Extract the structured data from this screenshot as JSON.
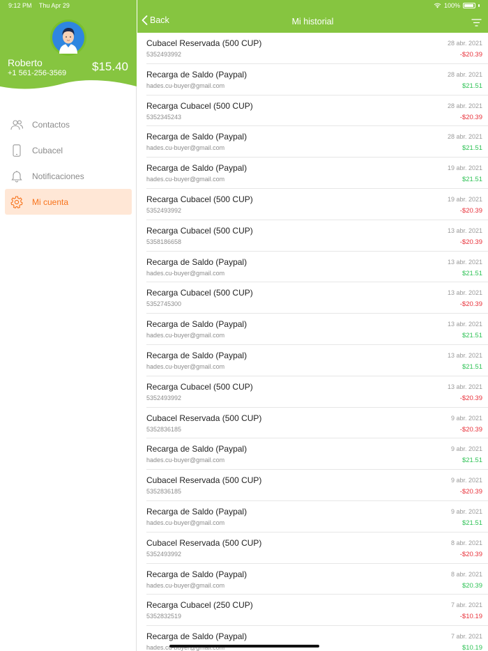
{
  "status_bar": {
    "time": "9:12 PM",
    "date": "Thu Apr 29",
    "battery": "100%"
  },
  "profile": {
    "name": "Roberto",
    "phone": "+1 561-256-3569",
    "balance": "$15.40"
  },
  "menu": [
    {
      "label": "Contactos",
      "icon": "contacts-icon"
    },
    {
      "label": "Cubacel",
      "icon": "phone-icon"
    },
    {
      "label": "Notificaciones",
      "icon": "bell-icon"
    },
    {
      "label": "Mi cuenta",
      "icon": "gear-icon",
      "active": true
    }
  ],
  "navbar": {
    "back_label": "Back",
    "title": "Mi historial"
  },
  "colors": {
    "brand_green": "#86c540",
    "accent_orange": "#f7731c",
    "negative": "#e8313a",
    "positive": "#2ec255"
  },
  "transactions": [
    {
      "title": "Cubacel Reservada (500 CUP)",
      "subtitle": "5352493992",
      "date": "28 abr. 2021",
      "amount": "-$20.39",
      "type": "neg"
    },
    {
      "title": "Recarga de Saldo (Paypal)",
      "subtitle": "hades.cu-buyer@gmail.com",
      "date": "28 abr. 2021",
      "amount": "$21.51",
      "type": "pos"
    },
    {
      "title": "Recarga Cubacel (500 CUP)",
      "subtitle": "5352345243",
      "date": "28 abr. 2021",
      "amount": "-$20.39",
      "type": "neg"
    },
    {
      "title": "Recarga de Saldo (Paypal)",
      "subtitle": "hades.cu-buyer@gmail.com",
      "date": "28 abr. 2021",
      "amount": "$21.51",
      "type": "pos"
    },
    {
      "title": "Recarga de Saldo (Paypal)",
      "subtitle": "hades.cu-buyer@gmail.com",
      "date": "19 abr. 2021",
      "amount": "$21.51",
      "type": "pos"
    },
    {
      "title": "Recarga Cubacel (500 CUP)",
      "subtitle": "5352493992",
      "date": "19 abr. 2021",
      "amount": "-$20.39",
      "type": "neg"
    },
    {
      "title": "Recarga Cubacel (500 CUP)",
      "subtitle": "5358186658",
      "date": "13 abr. 2021",
      "amount": "-$20.39",
      "type": "neg"
    },
    {
      "title": "Recarga de Saldo (Paypal)",
      "subtitle": "hades.cu-buyer@gmail.com",
      "date": "13 abr. 2021",
      "amount": "$21.51",
      "type": "pos"
    },
    {
      "title": "Recarga Cubacel (500 CUP)",
      "subtitle": "5352745300",
      "date": "13 abr. 2021",
      "amount": "-$20.39",
      "type": "neg"
    },
    {
      "title": "Recarga de Saldo (Paypal)",
      "subtitle": "hades.cu-buyer@gmail.com",
      "date": "13 abr. 2021",
      "amount": "$21.51",
      "type": "pos"
    },
    {
      "title": "Recarga de Saldo (Paypal)",
      "subtitle": "hades.cu-buyer@gmail.com",
      "date": "13 abr. 2021",
      "amount": "$21.51",
      "type": "pos"
    },
    {
      "title": "Recarga Cubacel (500 CUP)",
      "subtitle": "5352493992",
      "date": "13 abr. 2021",
      "amount": "-$20.39",
      "type": "neg"
    },
    {
      "title": "Cubacel Reservada (500 CUP)",
      "subtitle": "5352836185",
      "date": "9 abr. 2021",
      "amount": "-$20.39",
      "type": "neg"
    },
    {
      "title": "Recarga de Saldo (Paypal)",
      "subtitle": "hades.cu-buyer@gmail.com",
      "date": "9 abr. 2021",
      "amount": "$21.51",
      "type": "pos"
    },
    {
      "title": "Cubacel Reservada (500 CUP)",
      "subtitle": "5352836185",
      "date": "9 abr. 2021",
      "amount": "-$20.39",
      "type": "neg"
    },
    {
      "title": "Recarga de Saldo (Paypal)",
      "subtitle": "hades.cu-buyer@gmail.com",
      "date": "9 abr. 2021",
      "amount": "$21.51",
      "type": "pos"
    },
    {
      "title": "Cubacel Reservada (500 CUP)",
      "subtitle": "5352493992",
      "date": "8 abr. 2021",
      "amount": "-$20.39",
      "type": "neg"
    },
    {
      "title": "Recarga de Saldo (Paypal)",
      "subtitle": "hades.cu-buyer@gmail.com",
      "date": "8 abr. 2021",
      "amount": "$20.39",
      "type": "pos"
    },
    {
      "title": "Recarga Cubacel (250 CUP)",
      "subtitle": "5352832519",
      "date": "7 abr. 2021",
      "amount": "-$10.19",
      "type": "neg"
    },
    {
      "title": "Recarga de Saldo (Paypal)",
      "subtitle": "hades.cu-buyer@gmail.com",
      "date": "7 abr. 2021",
      "amount": "$10.19",
      "type": "pos"
    }
  ]
}
